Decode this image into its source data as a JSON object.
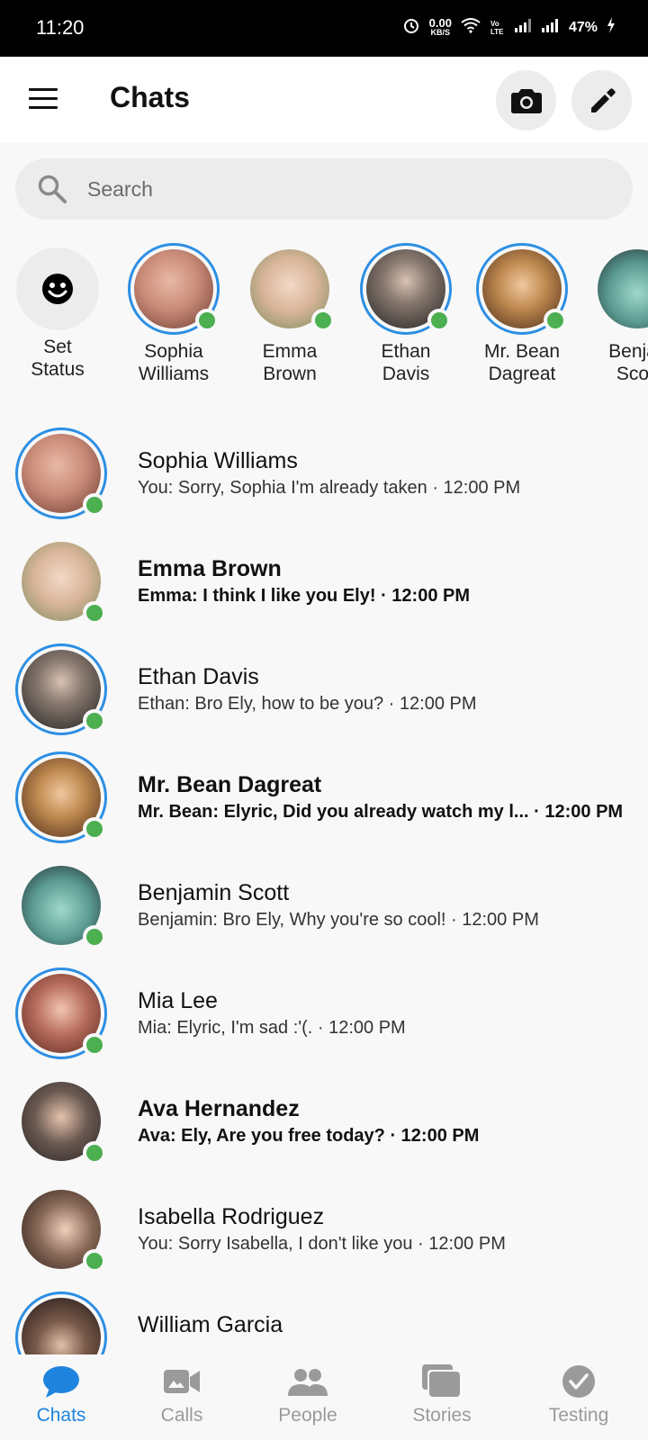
{
  "status_bar": {
    "time": "11:20",
    "net_speed_value": "0.00",
    "net_speed_unit": "KB/S",
    "battery": "47%",
    "icons": [
      "alarm-icon",
      "wifi-icon",
      "volte-icon",
      "signal-icon",
      "signal-icon",
      "battery-charging-icon"
    ]
  },
  "header": {
    "title": "Chats",
    "menu_icon": "hamburger-menu-icon",
    "camera_icon": "camera-icon",
    "compose_icon": "pencil-icon"
  },
  "search": {
    "placeholder": "Search",
    "value": ""
  },
  "stories": [
    {
      "label_line1": "Set",
      "label_line2": "Status",
      "icon": "smiley-icon",
      "ring": false,
      "online": false
    },
    {
      "label_line1": "Sophia",
      "label_line2": "Williams",
      "ring": true,
      "online": true,
      "color": "#c98a78"
    },
    {
      "label_line1": "Emma",
      "label_line2": "Brown",
      "ring": false,
      "online": true,
      "color": "#d9b59a"
    },
    {
      "label_line1": "Ethan",
      "label_line2": "Davis",
      "ring": true,
      "online": true,
      "color": "#4a4a4a"
    },
    {
      "label_line1": "Mr. Bean",
      "label_line2": "Dagreat",
      "ring": true,
      "online": true,
      "color": "#8a5a2a"
    },
    {
      "label_line1": "Benja",
      "label_line2": "Sco",
      "ring": false,
      "online": false,
      "color": "#2f3b44"
    }
  ],
  "chats": [
    {
      "name": "Sophia Williams",
      "preview": "You: Sorry, Sophia I'm already taken · 12:00 PM",
      "unread": false,
      "ring": true,
      "online": true,
      "color": "#c98a78"
    },
    {
      "name": "Emma Brown",
      "preview": "Emma: I think I like you Ely! · 12:00 PM",
      "unread": true,
      "ring": false,
      "online": true,
      "color": "#d9b59a"
    },
    {
      "name": "Ethan Davis",
      "preview": "Ethan: Bro Ely, how to be you? · 12:00 PM",
      "unread": false,
      "ring": true,
      "online": true,
      "color": "#4a4a4a"
    },
    {
      "name": "Mr. Bean Dagreat",
      "preview": "Mr. Bean: Elyric, Did you already watch my l... · 12:00 PM",
      "unread": true,
      "ring": true,
      "online": true,
      "color": "#8a5a2a"
    },
    {
      "name": "Benjamin Scott",
      "preview": "Benjamin: Bro Ely, Why you're so cool! · 12:00 PM",
      "unread": false,
      "ring": false,
      "online": true,
      "color": "#2f3b44"
    },
    {
      "name": "Mia Lee",
      "preview": "Mia: Elyric, I'm sad :'(. · 12:00 PM",
      "unread": false,
      "ring": true,
      "online": true,
      "color": "#b56a5a"
    },
    {
      "name": "Ava Hernandez",
      "preview": "Ava: Ely, Are you free today? · 12:00 PM",
      "unread": true,
      "ring": false,
      "online": true,
      "color": "#6b5a52"
    },
    {
      "name": "Isabella Rodriguez",
      "preview": "You: Sorry Isabella, I don't like you · 12:00 PM",
      "unread": false,
      "ring": false,
      "online": true,
      "color": "#8a6a58"
    },
    {
      "name": "William Garcia",
      "preview": "",
      "unread": false,
      "ring": true,
      "online": false,
      "color": "#3a3030"
    }
  ],
  "bottom_nav": [
    {
      "label": "Chats",
      "icon": "chat-bubble-icon",
      "active": true
    },
    {
      "label": "Calls",
      "icon": "video-camera-icon",
      "active": false
    },
    {
      "label": "People",
      "icon": "people-icon",
      "active": false
    },
    {
      "label": "Stories",
      "icon": "stories-icon",
      "active": false
    },
    {
      "label": "Testing",
      "icon": "check-circle-icon",
      "active": false
    }
  ],
  "colors": {
    "accent": "#1e84dd",
    "ring": "#2d8fe4",
    "online": "#4caf50",
    "inactive": "#9a9a9a"
  }
}
